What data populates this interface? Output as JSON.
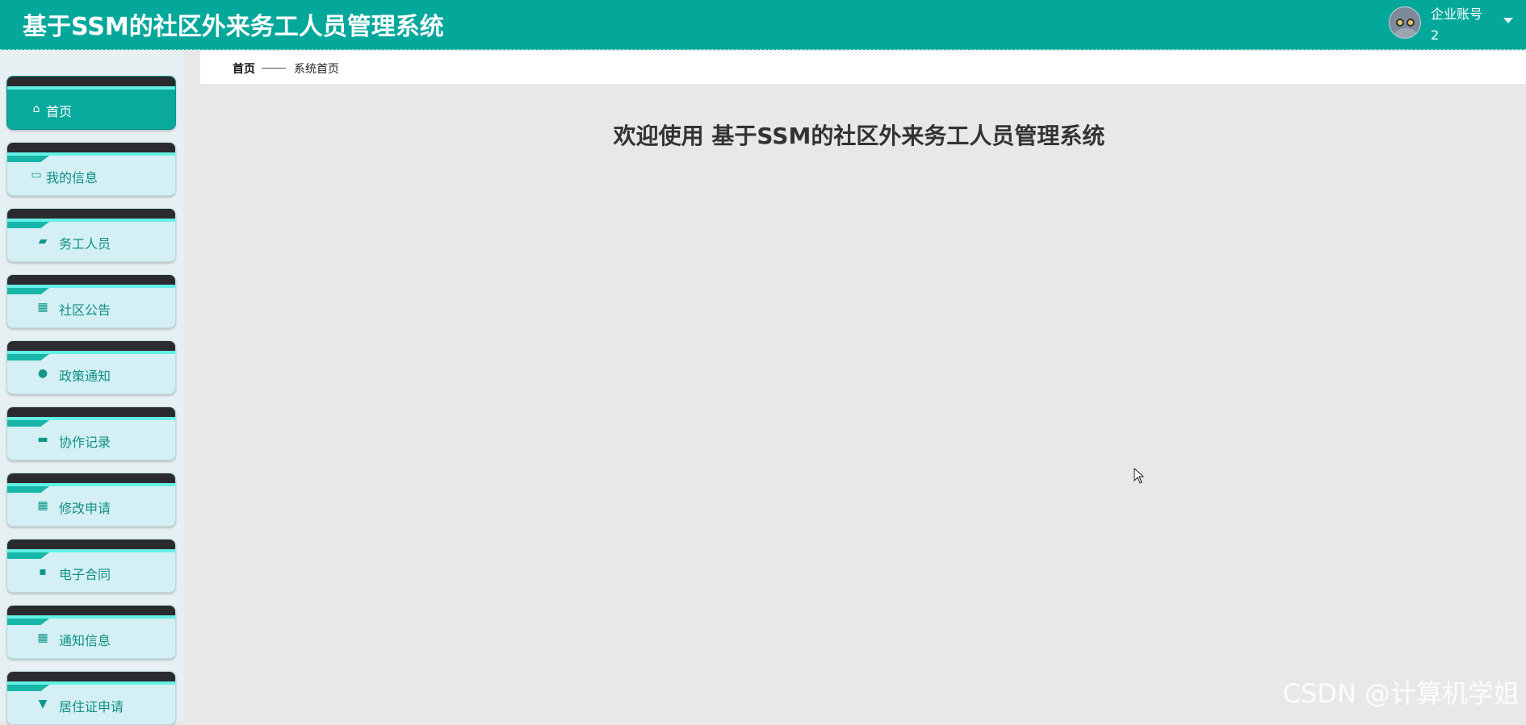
{
  "header": {
    "app_title": "基于SSM的社区外来务工人员管理系统",
    "user_role": "企业账号",
    "user_id": "2"
  },
  "sidebar": {
    "items": [
      {
        "label": "首页",
        "icon": "home-icon",
        "active": true
      },
      {
        "label": "我的信息",
        "icon": "wallet-icon"
      },
      {
        "label": "务工人员",
        "icon": "ticket-icon"
      },
      {
        "label": "社区公告",
        "icon": "grid-icon"
      },
      {
        "label": "政策通知",
        "icon": "user-icon"
      },
      {
        "label": "协作记录",
        "icon": "briefcase-icon"
      },
      {
        "label": "修改申请",
        "icon": "apps-icon"
      },
      {
        "label": "电子合同",
        "icon": "chat-icon"
      },
      {
        "label": "通知信息",
        "icon": "grid-icon"
      },
      {
        "label": "居住证申请",
        "icon": "pin-icon"
      }
    ]
  },
  "breadcrumb": {
    "home": "首页",
    "current": "系统首页"
  },
  "main": {
    "welcome": "欢迎使用 基于SSM的社区外来务工人员管理系统"
  },
  "watermark": "CSDN @计算机学姐",
  "colors": {
    "primary": "#03a89b",
    "nav_bg": "#d4f0f4",
    "nav_text": "#0f8f86"
  }
}
